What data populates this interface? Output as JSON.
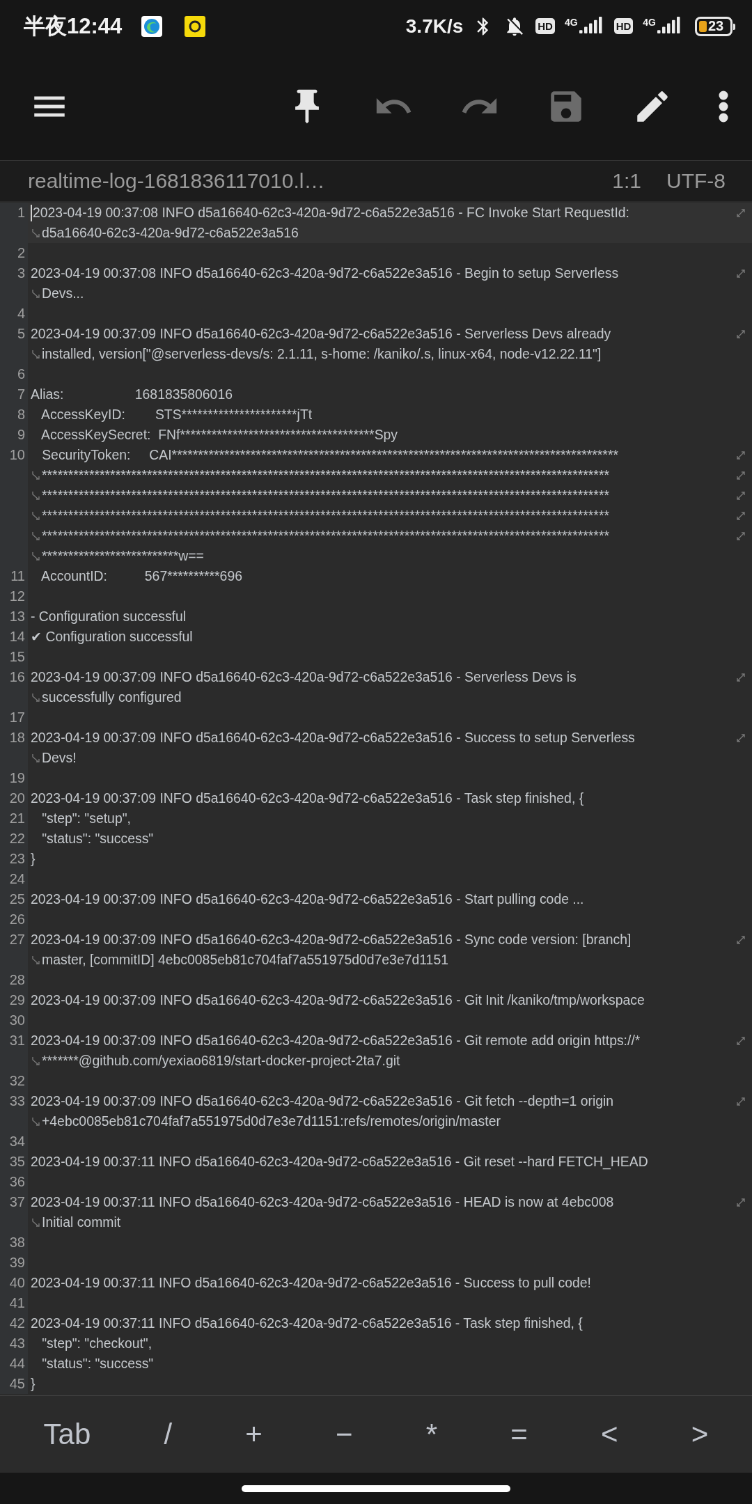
{
  "status_bar": {
    "time": "半夜12:44",
    "speed": "3.7K/s",
    "sims": [
      {
        "hd": "HD",
        "network": "4G"
      },
      {
        "hd": "HD",
        "network": "4G"
      }
    ],
    "battery": "23"
  },
  "toolbar": [
    {
      "kind": "menu",
      "disabled": false
    },
    {
      "kind": "pin",
      "disabled": false
    },
    {
      "kind": "undo",
      "disabled": true
    },
    {
      "kind": "redo",
      "disabled": true
    },
    {
      "kind": "save",
      "disabled": true
    },
    {
      "kind": "edit",
      "disabled": false
    },
    {
      "kind": "more",
      "disabled": false
    }
  ],
  "file_bar": {
    "filename": "realtime-log-1681836117010.l…",
    "position": "1:1",
    "encoding": "UTF-8"
  },
  "lines": [
    {
      "number": "1",
      "current": true,
      "rows": [
        "2023-04-19 00:37:08 INFO d5a16640-62c3-420a-9d72-c6a522e3a516 - FC Invoke Start RequestId:",
        "d5a16640-62c3-420a-9d72-c6a522e3a516"
      ]
    },
    {
      "number": "2",
      "current": false
    },
    {
      "number": "3",
      "current": false,
      "rows": [
        "2023-04-19 00:37:08 INFO d5a16640-62c3-420a-9d72-c6a522e3a516 - Begin to setup Serverless",
        "Devs..."
      ]
    },
    {
      "number": "4",
      "current": false
    },
    {
      "number": "5",
      "current": false,
      "rows": [
        "2023-04-19 00:37:09 INFO d5a16640-62c3-420a-9d72-c6a522e3a516 - Serverless Devs already",
        "installed, version[\"@serverless-devs/s: 2.1.11, s-home: /kaniko/.s, linux-x64, node-v12.22.11\"]"
      ]
    },
    {
      "number": "6",
      "current": false
    },
    {
      "number": "7",
      "current": false,
      "rows": [
        "Alias:                   1681835806016"
      ]
    },
    {
      "number": "8",
      "current": false,
      "rows": [
        "   AccessKeyID:        STS**********************jTt"
      ]
    },
    {
      "number": "9",
      "current": false,
      "rows": [
        "   AccessKeySecret:  FNf*************************************Spy"
      ]
    },
    {
      "number": "10",
      "current": false,
      "rows": [
        "   SecurityToken:     CAI*************************************************************************************",
        "************************************************************************************************************",
        "************************************************************************************************************",
        "************************************************************************************************************",
        "************************************************************************************************************",
        "**************************w=="
      ]
    },
    {
      "number": "11",
      "current": false,
      "rows": [
        "   AccountID:          567**********696"
      ]
    },
    {
      "number": "12",
      "current": false
    },
    {
      "number": "13",
      "current": false,
      "rows": [
        "- Configuration successful"
      ]
    },
    {
      "number": "14",
      "current": false,
      "rows": [
        "✔ Configuration successful"
      ]
    },
    {
      "number": "15",
      "current": false
    },
    {
      "number": "16",
      "current": false,
      "rows": [
        "2023-04-19 00:37:09 INFO d5a16640-62c3-420a-9d72-c6a522e3a516 - Serverless Devs is",
        "successfully configured"
      ]
    },
    {
      "number": "17",
      "current": false
    },
    {
      "number": "18",
      "current": false,
      "rows": [
        "2023-04-19 00:37:09 INFO d5a16640-62c3-420a-9d72-c6a522e3a516 - Success to setup Serverless",
        "Devs!"
      ]
    },
    {
      "number": "19",
      "current": false
    },
    {
      "number": "20",
      "current": false,
      "rows": [
        "2023-04-19 00:37:09 INFO d5a16640-62c3-420a-9d72-c6a522e3a516 - Task step finished, {"
      ]
    },
    {
      "number": "21",
      "current": false,
      "rows": [
        "   \"step\": \"setup\","
      ]
    },
    {
      "number": "22",
      "current": false,
      "rows": [
        "   \"status\": \"success\""
      ]
    },
    {
      "number": "23",
      "current": false,
      "rows": [
        "}"
      ]
    },
    {
      "number": "24",
      "current": false
    },
    {
      "number": "25",
      "current": false,
      "rows": [
        "2023-04-19 00:37:09 INFO d5a16640-62c3-420a-9d72-c6a522e3a516 - Start pulling code ..."
      ]
    },
    {
      "number": "26",
      "current": false
    },
    {
      "number": "27",
      "current": false,
      "rows": [
        "2023-04-19 00:37:09 INFO d5a16640-62c3-420a-9d72-c6a522e3a516 - Sync code version: [branch]",
        "master, [commitID] 4ebc0085eb81c704faf7a551975d0d7e3e7d1151"
      ]
    },
    {
      "number": "28",
      "current": false
    },
    {
      "number": "29",
      "current": false,
      "rows": [
        "2023-04-19 00:37:09 INFO d5a16640-62c3-420a-9d72-c6a522e3a516 - Git Init /kaniko/tmp/workspace"
      ]
    },
    {
      "number": "30",
      "current": false
    },
    {
      "number": "31",
      "current": false,
      "rows": [
        "2023-04-19 00:37:09 INFO d5a16640-62c3-420a-9d72-c6a522e3a516 - Git remote add origin https://*",
        "*******@github.com/yexiao6819/start-docker-project-2ta7.git"
      ]
    },
    {
      "number": "32",
      "current": false
    },
    {
      "number": "33",
      "current": false,
      "rows": [
        "2023-04-19 00:37:09 INFO d5a16640-62c3-420a-9d72-c6a522e3a516 - Git fetch --depth=1 origin",
        "+4ebc0085eb81c704faf7a551975d0d7e3e7d1151:refs/remotes/origin/master"
      ]
    },
    {
      "number": "34",
      "current": false
    },
    {
      "number": "35",
      "current": false,
      "rows": [
        "2023-04-19 00:37:11 INFO d5a16640-62c3-420a-9d72-c6a522e3a516 - Git reset --hard FETCH_HEAD"
      ]
    },
    {
      "number": "36",
      "current": false
    },
    {
      "number": "37",
      "current": false,
      "rows": [
        "2023-04-19 00:37:11 INFO d5a16640-62c3-420a-9d72-c6a522e3a516 - HEAD is now at 4ebc008",
        "Initial commit"
      ]
    },
    {
      "number": "38",
      "current": false
    },
    {
      "number": "39",
      "current": false
    },
    {
      "number": "40",
      "current": false,
      "rows": [
        "2023-04-19 00:37:11 INFO d5a16640-62c3-420a-9d72-c6a522e3a516 - Success to pull code!"
      ]
    },
    {
      "number": "41",
      "current": false
    },
    {
      "number": "42",
      "current": false,
      "rows": [
        "2023-04-19 00:37:11 INFO d5a16640-62c3-420a-9d72-c6a522e3a516 - Task step finished, {"
      ]
    },
    {
      "number": "43",
      "current": false,
      "rows": [
        "   \"step\": \"checkout\","
      ]
    },
    {
      "number": "44",
      "current": false,
      "rows": [
        "   \"status\": \"success\""
      ]
    },
    {
      "number": "45",
      "current": false,
      "rows": [
        "}"
      ]
    }
  ],
  "keys": [
    "Tab",
    "/",
    "+",
    "−",
    "*",
    "=",
    "<",
    ">"
  ]
}
